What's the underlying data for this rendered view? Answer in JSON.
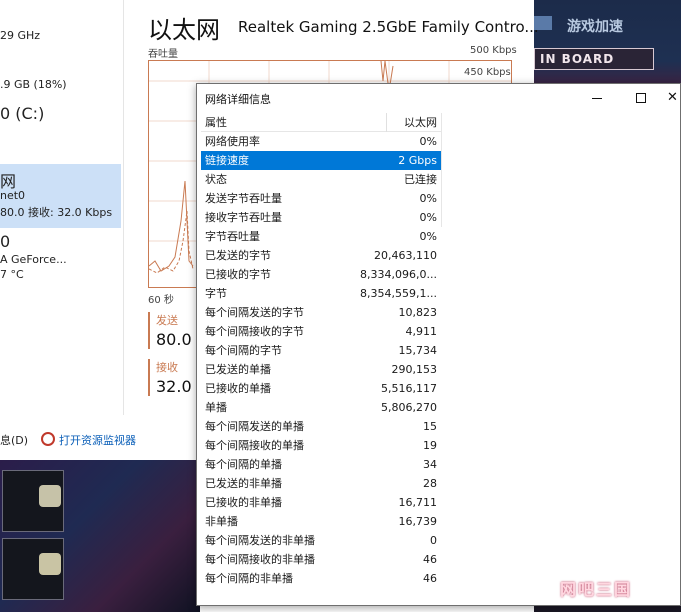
{
  "left_panel": {
    "cpu_speed": "29 GHz",
    "memory_usage": ".9 GB (18%)",
    "disk_label": "0 (C:)",
    "ethernet_title": "网",
    "ethernet_name": "net0",
    "ethernet_rates": "80.0  接收: 32.0 Kbps",
    "gpu_label": "0",
    "gpu_name": "A GeForce...",
    "gpu_temp": "7 °C"
  },
  "main": {
    "title": "以太网",
    "adapter_name": "Realtek Gaming 2.5GbE Family Contro...",
    "throughput_label": "吞吐量",
    "max_scale": "500 Kbps",
    "scale_2": "450 Kbps",
    "time_label": "60 秒",
    "send_label": "发送",
    "send_value": "80.0",
    "receive_label": "接收",
    "receive_value": "32.0"
  },
  "bottom_links": {
    "less_details": "息(D)",
    "open_resource_monitor": "打开资源监视器"
  },
  "background": {
    "banner_text": "游戏加速",
    "board_text": "IN BOARD",
    "watermark": "网吧三国"
  },
  "dialog": {
    "title": "网络详细信息",
    "columns": {
      "property": "属性",
      "value": "以太网"
    },
    "rows": [
      {
        "property": "网络使用率",
        "value": "0%"
      },
      {
        "property": "链接速度",
        "value": "2 Gbps",
        "selected": true
      },
      {
        "property": "状态",
        "value": "已连接"
      },
      {
        "property": "发送字节吞吐量",
        "value": "0%"
      },
      {
        "property": "接收字节吞吐量",
        "value": "0%"
      },
      {
        "property": "字节吞吐量",
        "value": "0%"
      },
      {
        "property": "已发送的字节",
        "value": "20,463,110"
      },
      {
        "property": "已接收的字节",
        "value": "8,334,096,0..."
      },
      {
        "property": "字节",
        "value": "8,354,559,1..."
      },
      {
        "property": "每个间隔发送的字节",
        "value": "10,823"
      },
      {
        "property": "每个间隔接收的字节",
        "value": "4,911"
      },
      {
        "property": "每个间隔的字节",
        "value": "15,734"
      },
      {
        "property": "已发送的单播",
        "value": "290,153"
      },
      {
        "property": "已接收的单播",
        "value": "5,516,117"
      },
      {
        "property": "单播",
        "value": "5,806,270"
      },
      {
        "property": "每个间隔发送的单播",
        "value": "15"
      },
      {
        "property": "每个间隔接收的单播",
        "value": "19"
      },
      {
        "property": "每个间隔的单播",
        "value": "34"
      },
      {
        "property": "已发送的非单播",
        "value": "28"
      },
      {
        "property": "已接收的非单播",
        "value": "16,711"
      },
      {
        "property": "非单播",
        "value": "16,739"
      },
      {
        "property": "每个间隔发送的非单播",
        "value": "0"
      },
      {
        "property": "每个间隔接收的非单播",
        "value": "46"
      },
      {
        "property": "每个间隔的非单播",
        "value": "46"
      }
    ]
  },
  "colors": {
    "selection": "#0078d7",
    "graph_line": "#c97a52",
    "link": "#0b5fb8"
  }
}
